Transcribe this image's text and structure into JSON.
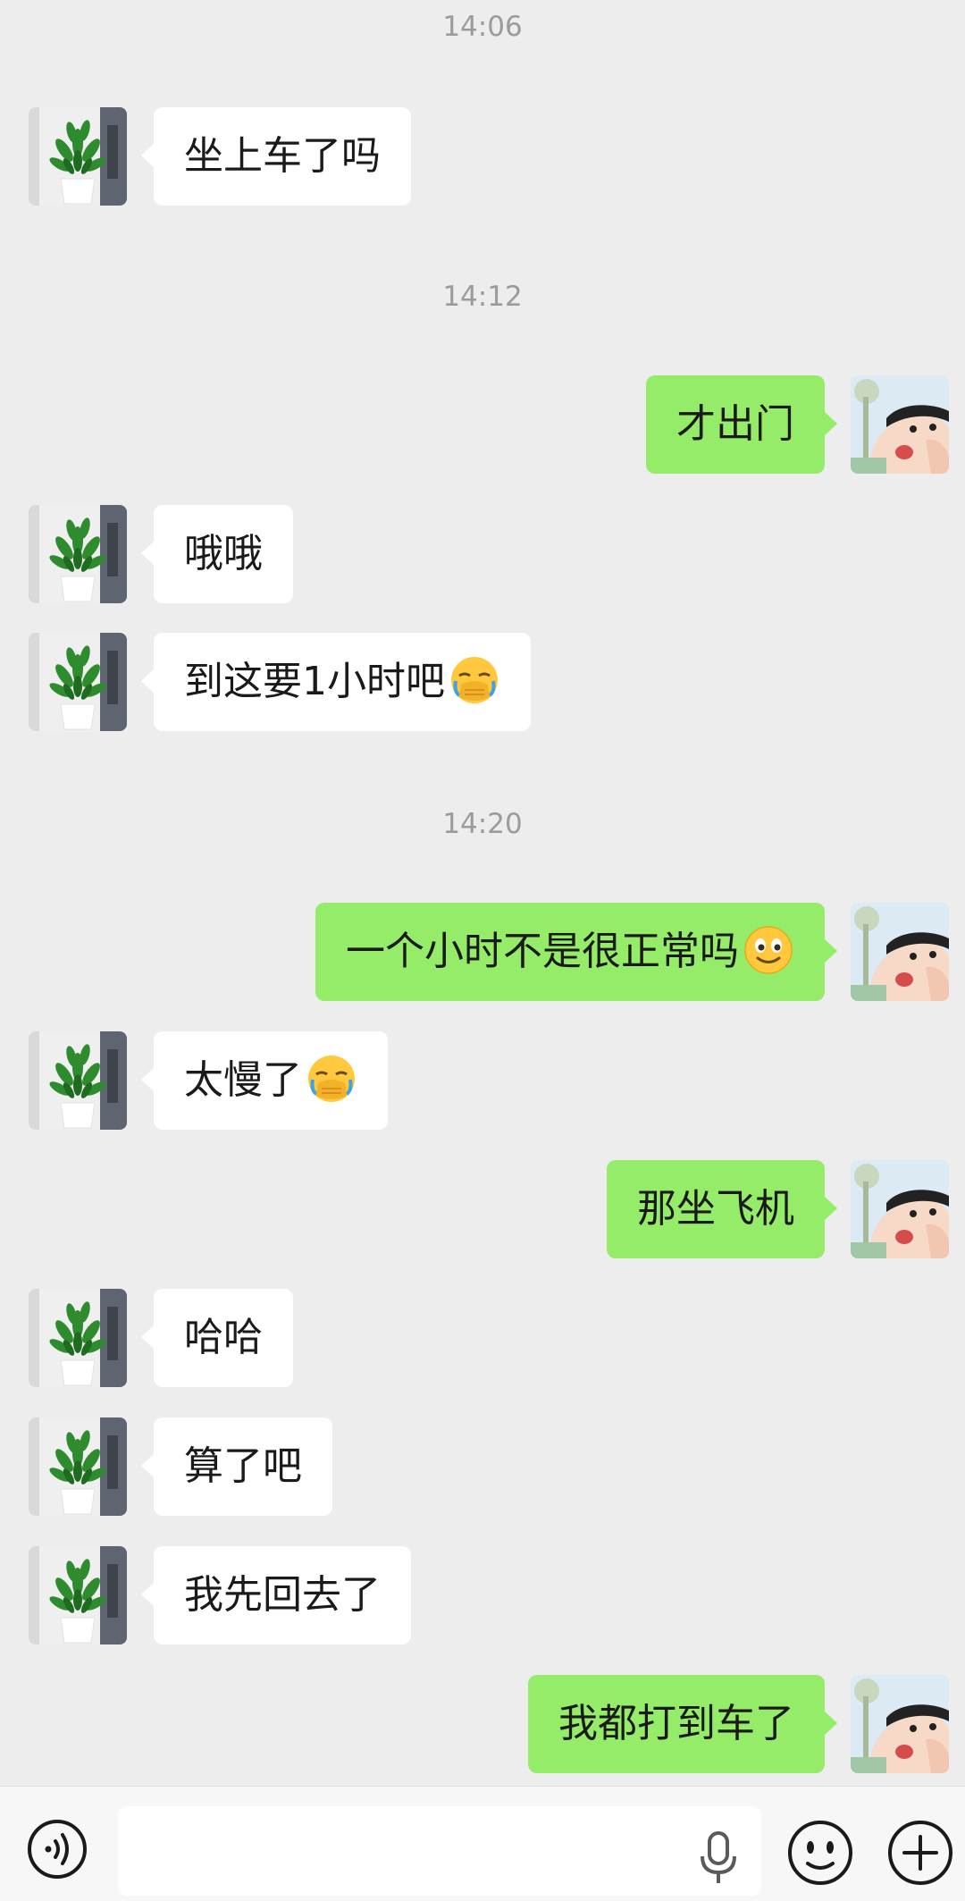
{
  "chat": {
    "timestamps": [
      "14:06",
      "14:12",
      "14:20"
    ],
    "messages": [
      {
        "side": "left",
        "text": "坐上车了吗"
      },
      {
        "side": "right",
        "text": "才出门"
      },
      {
        "side": "left",
        "text": "哦哦"
      },
      {
        "side": "left",
        "text": "到这要1小时吧",
        "emoji": "facepalm-emoji"
      },
      {
        "side": "right",
        "text": "一个小时不是很正常吗",
        "emoji": "smile-emoji"
      },
      {
        "side": "left",
        "text": "太慢了",
        "emoji": "facepalm-emoji"
      },
      {
        "side": "right",
        "text": "那坐飞机"
      },
      {
        "side": "left",
        "text": "哈哈"
      },
      {
        "side": "left",
        "text": "算了吧"
      },
      {
        "side": "left",
        "text": "我先回去了"
      },
      {
        "side": "right",
        "text": "我都打到车了"
      }
    ]
  },
  "input_bar": {
    "icons": [
      "voice-mode-icon",
      "microphone-icon",
      "emoji-sticker-icon",
      "plus-more-icon"
    ]
  },
  "colors": {
    "background": "#EDEDED",
    "received_bubble": "#FFFFFF",
    "sent_bubble": "#95EC69",
    "timestamp_text": "#9B9B9B"
  }
}
